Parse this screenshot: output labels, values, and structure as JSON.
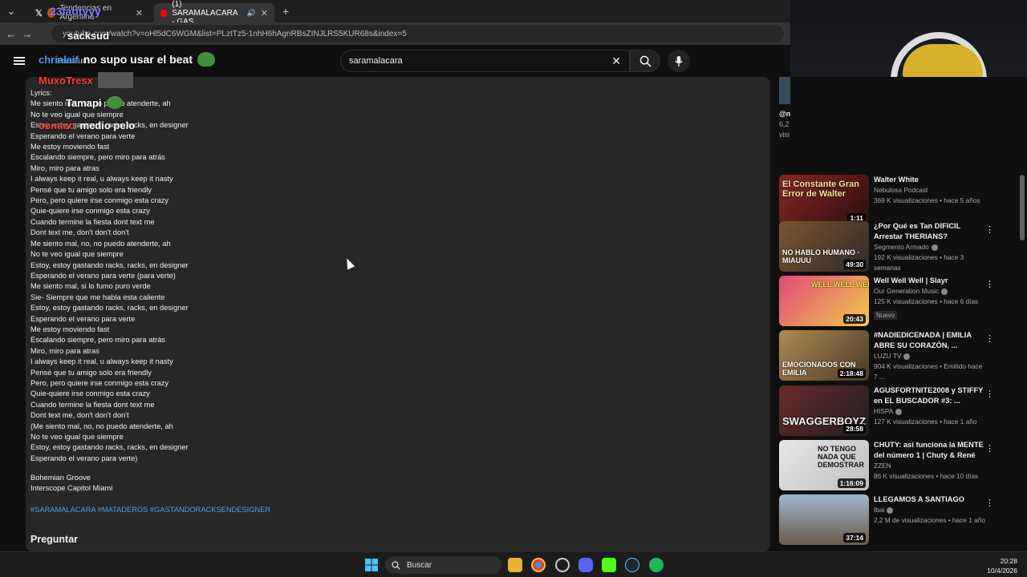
{
  "browser": {
    "tabs": [
      {
        "label": "Tendencias en Argentina",
        "icon_color": "#ffffff"
      },
      {
        "label": "(1) SARAMALACARA - GAS",
        "icon_color": "#ff0000"
      }
    ],
    "new_tab_label": "+",
    "url": "youtube.com/watch?v=oHl5dC6WGM&list=PLztTz5-1nhH6hAgnRBsZINJLRS5KUR68s&index=5"
  },
  "header": {
    "search_value": "saramalacara",
    "logo_text": "Premium"
  },
  "chat": [
    {
      "user": "23lautyyy",
      "message": "",
      "color": "#7b7bff"
    },
    {
      "user": "sacksud",
      "message": "",
      "color": "#ffffff"
    },
    {
      "user": "chrialaif",
      "message": "no supo usar el beat",
      "color": "#4a9cff"
    },
    {
      "user": "MuxoTresx",
      "message": "",
      "color": "#ff3b3b"
    },
    {
      "user": "Tamapi",
      "message": "",
      "color": "#ffffff"
    },
    {
      "user": "oenaco",
      "message": "medio pelo",
      "color": "#ff3b3b"
    }
  ],
  "description": {
    "lyrics_header": "Lyrics:",
    "lyrics": [
      "Me siento mal, no, no puedo atenderte, ah",
      "No te veo igual que siempre",
      "Estoy, estoy gastando racks, racks, en designer",
      "Esperando el verano para verte",
      "Me estoy moviendo fast",
      "Escalando siempre, pero miro para atrás",
      "Miro, miro para atras",
      "I always keep it real, u always keep it nasty",
      "Pensé que tu amigo solo era friendly",
      "Pero, pero quiere irse conmigo esta crazy",
      "Quie-quiere irse conmigo esta crazy",
      "Cuando termine la fiesta dont text me",
      "Dont text me, don't don't don't",
      "Me siento mal, no, no puedo atenderte, ah",
      "No te veo igual que siempre",
      "Estoy, estoy gastando racks, racks, en designer",
      "Esperando el verano para verte (para verte)",
      "Me siento mal, si lo fumo puro verde",
      "Sie- Siempre que me habla esta caliente",
      "Estoy, estoy gastando racks, racks, en designer",
      "Esperando el verano para verte",
      "Me estoy moviendo fast",
      "Escalando siempre, pero miro para atrás",
      "Miro, miro para atras",
      "I always keep it real, u always keep it nasty",
      "Pensé que tu amigo solo era friendly",
      "Pero, pero quiere irse conmigo esta crazy",
      "Quie-quiere irse conmigo esta crazy",
      "Cuando termine la fiesta dont text me",
      "Dont text me, don't don't don't",
      "(Me siento mal, no, no puedo atenderte, ah",
      "No te veo igual que siempre",
      "Estoy, estoy gastando racks, racks, en designer",
      "Esperando el verano para verte)"
    ],
    "credits": [
      "Bohemian Groove",
      "Interscope Capitol Miami"
    ],
    "hashtags": "#SARAMALACARA #MATADEROS #GASTANDORACKSENDESIGNER",
    "ask_label": "Preguntar"
  },
  "side_peek": [
    "@n",
    "6,2",
    "visi"
  ],
  "recommendations": [
    {
      "title": "Walter White",
      "channel": "Nebulosa Podcast",
      "meta": "369 K visualizaciones • hace 5 años",
      "duration": "1:11",
      "thumb_text": "El Constante Gran Error de Walter",
      "thumb_color": "#7a1f1f",
      "verified": false,
      "new": false
    },
    {
      "title": "¿Por Qué es Tan DIFICIL Arrestar THERIANS?",
      "channel": "Segmento Armado",
      "meta": "192 K visualizaciones • hace 3 semanas",
      "duration": "49:30",
      "thumb_text": "NO HABLO HUMANO · MIAUUU",
      "thumb_color": "#6b4a2a",
      "verified": true,
      "new": false
    },
    {
      "title": "Well Well Well | Slayr",
      "channel": "Our Generation Music",
      "meta": "125 K visualizaciones • hace 6 días",
      "duration": "20:43",
      "thumb_text": "WELL WELL WELL",
      "thumb_color": "#c83a6a",
      "verified": true,
      "new": true,
      "new_label": "Nuevo"
    },
    {
      "title": "#NADIEDICENADA | EMILIA ABRE SU CORAZÓN, ...",
      "channel": "LUZU TV",
      "meta": "904 K visualizaciones • Emitido hace 7 ...",
      "duration": "2:18:48",
      "thumb_text": "EMOCIONADOS CON EMILIA",
      "thumb_color": "#8a6a3a",
      "verified": true,
      "new": false
    },
    {
      "title": "AGUSFORTNITE2008 y STIFFY en EL BUSCADOR #3: ...",
      "channel": "HISPA",
      "meta": "127 K visualizaciones • hace 1 año",
      "duration": "28:58",
      "thumb_text": "SWAGGERBOYZ",
      "thumb_color": "#5a2a2a",
      "verified": true,
      "new": false
    },
    {
      "title": "CHUTY: así funciona la MENTE del número 1 | Chuty & René Z...",
      "channel": "ZZEN",
      "meta": "86 K visualizaciones • hace 10 días",
      "duration": "1:16:09",
      "thumb_text": "NO TENGO NADA QUE DEMOSTRAR",
      "thumb_color": "#dcdcdc",
      "verified": false,
      "new": false
    },
    {
      "title": "LLEGAMOS A SANTIAGO",
      "channel": "Ibai",
      "meta": "2,2 M de visualizaciones • hace 1 año",
      "duration": "37:14",
      "thumb_text": "",
      "thumb_color": "#8aa0b5",
      "verified": true,
      "new": false
    }
  ],
  "taskbar": {
    "search_label": "Buscar",
    "time": "20:28",
    "date": "10/4/2026"
  }
}
